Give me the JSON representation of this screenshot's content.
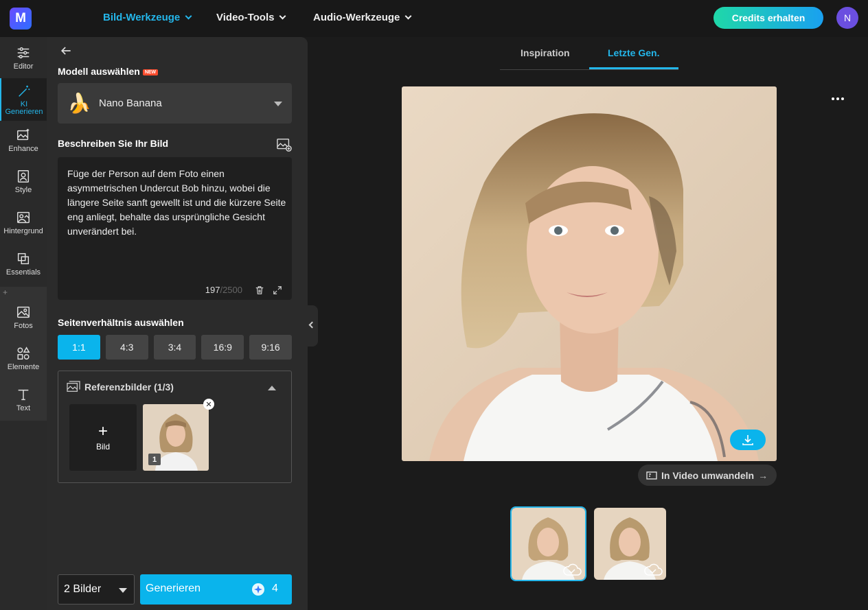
{
  "app": {
    "logo_letter": "M"
  },
  "nav": {
    "items": [
      {
        "label": "Bild-Werkzeuge",
        "active": true
      },
      {
        "label": "Video-Tools",
        "active": false
      },
      {
        "label": "Audio-Werkzeuge",
        "active": false
      }
    ],
    "credits_button": "Credits erhalten",
    "avatar_initial": "N"
  },
  "rail": {
    "items": [
      {
        "label": "Editor",
        "icon": "sliders-icon"
      },
      {
        "label": "KI\nGenerieren",
        "icon": "magic-wand-icon",
        "active": true
      },
      {
        "label": "Enhance",
        "icon": "enhance-image-icon"
      },
      {
        "label": "Style",
        "icon": "style-portrait-icon"
      },
      {
        "label": "Hintergrund",
        "icon": "background-image-icon"
      },
      {
        "label": "Essentials",
        "icon": "overlap-squares-icon"
      },
      {
        "label": "Fotos",
        "icon": "photo-icon"
      },
      {
        "label": "Elemente",
        "icon": "shapes-icon"
      },
      {
        "label": "Text",
        "icon": "text-icon"
      }
    ],
    "sep_symbol": "+"
  },
  "panel": {
    "model_label": "Modell auswählen",
    "model_badge": "NEW",
    "model_value": "Nano Banana",
    "model_emoji": "🍌",
    "describe_label": "Beschreiben Sie Ihr Bild",
    "prompt": "Füge der Person auf dem Foto einen asymmetrischen Undercut Bob hinzu, wobei die längere Seite sanft gewellt ist und die kürzere Seite eng anliegt, behalte das ursprüngliche Gesicht unverändert bei.",
    "char_count": "197",
    "char_max": "/2500",
    "ratio_label": "Seitenverhältnis auswählen",
    "ratios": [
      {
        "label": "1:1",
        "active": true
      },
      {
        "label": "4:3",
        "active": false
      },
      {
        "label": "3:4",
        "active": false
      },
      {
        "label": "16:9",
        "active": false
      },
      {
        "label": "9:16",
        "active": false
      }
    ],
    "reference_label": "Referenzbilder (1/3)",
    "add_image_label": "Bild",
    "reference_number": "1",
    "image_count": "2 Bilder",
    "generate_label": "Generieren",
    "generate_cost": "4"
  },
  "main": {
    "tabs": [
      {
        "label": "Inspiration",
        "active": false
      },
      {
        "label": "Letzte Gen.",
        "active": true
      }
    ],
    "video_button": "In Video umwandeln"
  },
  "colors": {
    "accent": "#0ab4ec",
    "bg": "#1b1b1b",
    "panel": "#2b2b2b"
  }
}
